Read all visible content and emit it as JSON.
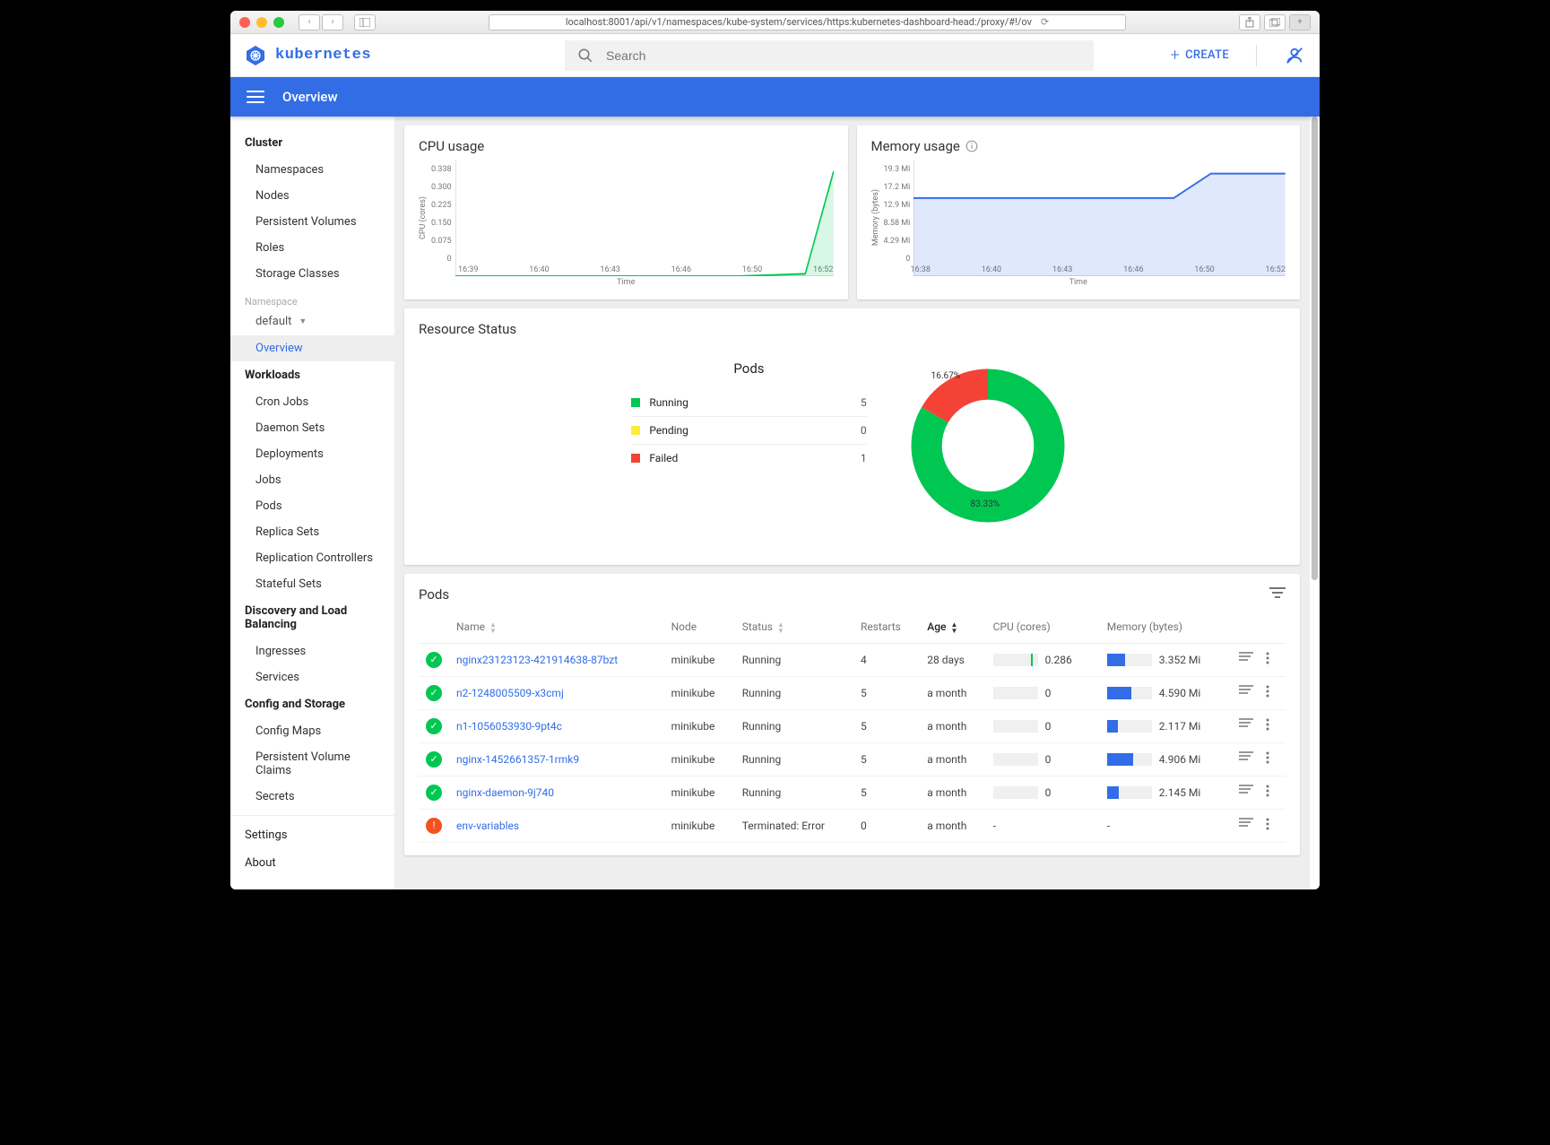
{
  "browser": {
    "url": "localhost:8001/api/v1/namespaces/kube-system/services/https:kubernetes-dashboard-head:/proxy/#!/ov"
  },
  "header": {
    "brand": "kubernetes",
    "search_placeholder": "Search",
    "create_label": "CREATE"
  },
  "bluebar": {
    "title": "Overview"
  },
  "sidebar": {
    "cluster_heading": "Cluster",
    "cluster_items": [
      "Namespaces",
      "Nodes",
      "Persistent Volumes",
      "Roles",
      "Storage Classes"
    ],
    "namespace_label": "Namespace",
    "namespace_value": "default",
    "overview": "Overview",
    "workloads_heading": "Workloads",
    "workloads_items": [
      "Cron Jobs",
      "Daemon Sets",
      "Deployments",
      "Jobs",
      "Pods",
      "Replica Sets",
      "Replication Controllers",
      "Stateful Sets"
    ],
    "discovery_heading": "Discovery and Load Balancing",
    "discovery_items": [
      "Ingresses",
      "Services"
    ],
    "config_heading": "Config and Storage",
    "config_items": [
      "Config Maps",
      "Persistent Volume Claims",
      "Secrets"
    ],
    "settings": "Settings",
    "about": "About"
  },
  "cpu_card": {
    "title": "CPU usage",
    "ylabel": "CPU (cores)",
    "xlabel": "Time"
  },
  "mem_card": {
    "title": "Memory usage",
    "ylabel": "Memory (bytes)",
    "xlabel": "Time"
  },
  "status_card": {
    "title": "Resource Status",
    "subheading": "Pods",
    "legend": [
      {
        "name": "Running",
        "value": "5",
        "color": "#00c752"
      },
      {
        "name": "Pending",
        "value": "0",
        "color": "#ffeb3b"
      },
      {
        "name": "Failed",
        "value": "1",
        "color": "#f44336"
      }
    ],
    "donut_green": "83.33%",
    "donut_red": "16.67%"
  },
  "pods_card": {
    "title": "Pods",
    "columns": [
      "Name",
      "Node",
      "Status",
      "Restarts",
      "Age",
      "CPU (cores)",
      "Memory (bytes)"
    ],
    "rows": [
      {
        "ok": true,
        "name": "nginx23123123-421914638-87bzt",
        "node": "minikube",
        "status": "Running",
        "restarts": "4",
        "age": "28 days",
        "cpu": "0.286",
        "cpu_pct": 88,
        "cpu_has_bar": true,
        "mem": "3.352 Mi",
        "mem_pct": 40
      },
      {
        "ok": true,
        "name": "n2-1248005509-x3cmj",
        "node": "minikube",
        "status": "Running",
        "restarts": "5",
        "age": "a month",
        "cpu": "0",
        "cpu_pct": 0,
        "cpu_has_bar": false,
        "mem": "4.590 Mi",
        "mem_pct": 55
      },
      {
        "ok": true,
        "name": "n1-1056053930-9pt4c",
        "node": "minikube",
        "status": "Running",
        "restarts": "5",
        "age": "a month",
        "cpu": "0",
        "cpu_pct": 0,
        "cpu_has_bar": false,
        "mem": "2.117 Mi",
        "mem_pct": 25
      },
      {
        "ok": true,
        "name": "nginx-1452661357-1rmk9",
        "node": "minikube",
        "status": "Running",
        "restarts": "5",
        "age": "a month",
        "cpu": "0",
        "cpu_pct": 0,
        "cpu_has_bar": false,
        "mem": "4.906 Mi",
        "mem_pct": 58
      },
      {
        "ok": true,
        "name": "nginx-daemon-9j740",
        "node": "minikube",
        "status": "Running",
        "restarts": "5",
        "age": "a month",
        "cpu": "0",
        "cpu_pct": 0,
        "cpu_has_bar": false,
        "mem": "2.145 Mi",
        "mem_pct": 26
      },
      {
        "ok": false,
        "name": "env-variables",
        "node": "minikube",
        "status": "Terminated: Error",
        "restarts": "0",
        "age": "a month",
        "cpu": "-",
        "cpu_pct": null,
        "cpu_has_bar": false,
        "mem": "-",
        "mem_pct": null
      }
    ]
  },
  "chart_data": [
    {
      "type": "line",
      "title": "CPU usage",
      "xlabel": "Time",
      "ylabel": "CPU (cores)",
      "y_ticks": [
        "0.338",
        "0.300",
        "0.225",
        "0.150",
        "0.075",
        "0"
      ],
      "x_ticks": [
        "16:39",
        "16:40",
        "16:43",
        "16:46",
        "16:50",
        "16:52"
      ],
      "ylim": [
        0,
        0.338
      ],
      "series": [
        {
          "name": "cpu",
          "color": "#00c752",
          "x": [
            "16:39",
            "16:40",
            "16:43",
            "16:46",
            "16:50",
            "16:51",
            "16:52"
          ],
          "y": [
            0,
            0,
            0,
            0,
            0,
            0.02,
            0.3
          ]
        }
      ]
    },
    {
      "type": "line",
      "title": "Memory usage",
      "xlabel": "Time",
      "ylabel": "Memory (bytes)",
      "y_ticks": [
        "19.3 Mi",
        "17.2 Mi",
        "12.9 Mi",
        "8.58 Mi",
        "4.29 Mi",
        "0"
      ],
      "x_ticks": [
        "16:38",
        "16:40",
        "16:43",
        "16:46",
        "16:50",
        "16:52"
      ],
      "ylim": [
        0,
        19.3
      ],
      "series": [
        {
          "name": "mem",
          "color": "#326de6",
          "x": [
            "16:38",
            "16:40",
            "16:43",
            "16:46",
            "16:48",
            "16:50",
            "16:52"
          ],
          "y": [
            12.9,
            12.9,
            12.9,
            12.9,
            12.9,
            17.2,
            17.2
          ]
        }
      ]
    },
    {
      "type": "pie",
      "title": "Pods",
      "slices": [
        {
          "name": "Running",
          "value": 5,
          "pct": 83.33,
          "color": "#00c752"
        },
        {
          "name": "Pending",
          "value": 0,
          "pct": 0,
          "color": "#ffeb3b"
        },
        {
          "name": "Failed",
          "value": 1,
          "pct": 16.67,
          "color": "#f44336"
        }
      ]
    }
  ]
}
